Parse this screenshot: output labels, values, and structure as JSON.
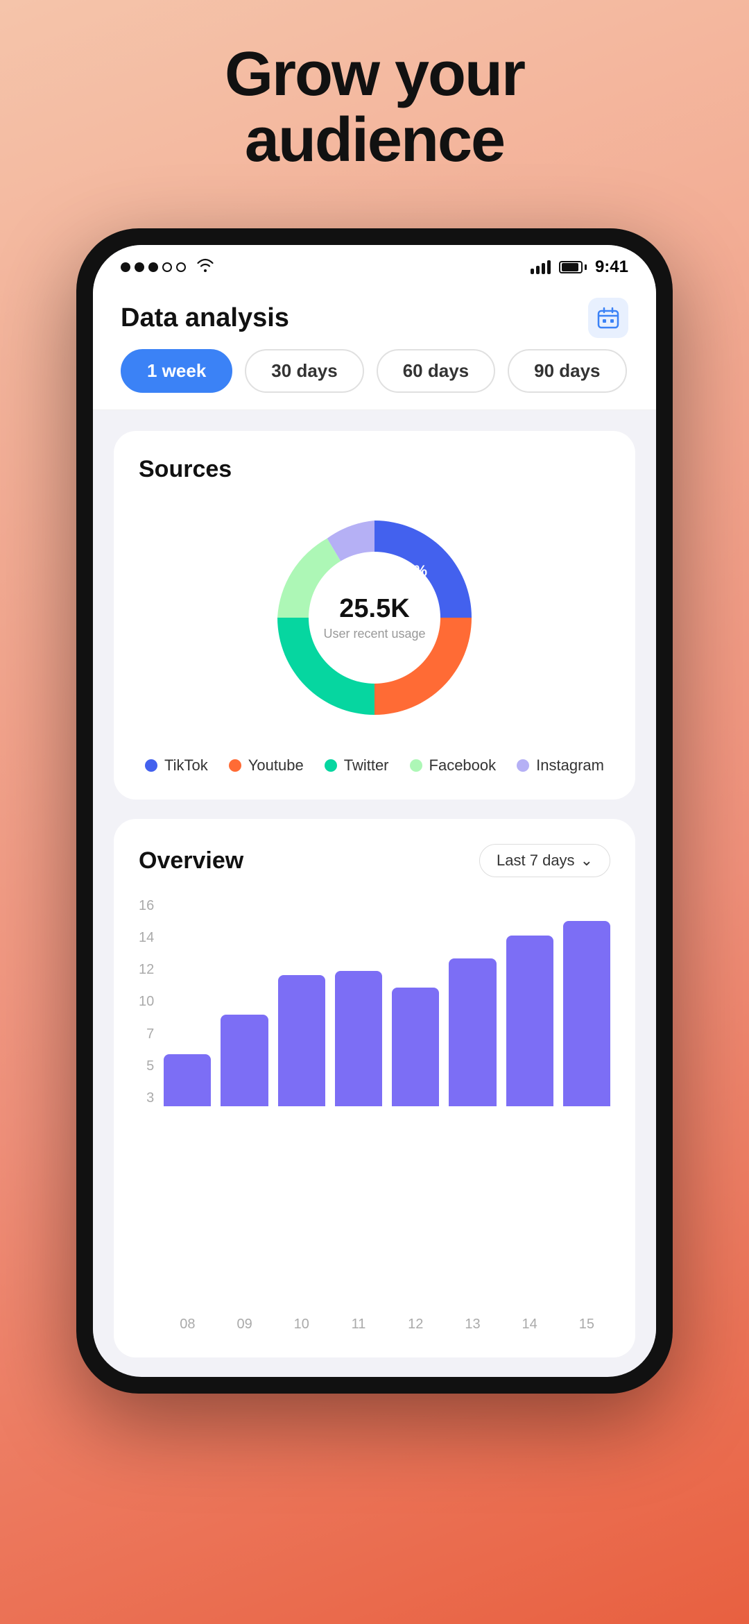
{
  "hero": {
    "line1": "Grow your",
    "line2": "audience"
  },
  "status_bar": {
    "time": "9:41",
    "dots": [
      "filled",
      "filled",
      "filled",
      "empty",
      "empty"
    ],
    "wifi": true,
    "signal_bars": 4,
    "battery_pct": 75
  },
  "header": {
    "title": "Data analysis",
    "calendar_icon": "📅"
  },
  "period_tabs": [
    {
      "label": "1 week",
      "active": true
    },
    {
      "label": "30 days",
      "active": false
    },
    {
      "label": "60 days",
      "active": false
    },
    {
      "label": "90 days",
      "active": false
    }
  ],
  "sources_card": {
    "title": "Sources",
    "donut": {
      "center_value": "25.5K",
      "center_label": "User recent usage",
      "segments": [
        {
          "label": "TikTok",
          "color": "#4361ee",
          "pct": 25,
          "start": 0,
          "end": 90
        },
        {
          "label": "Youtube",
          "color": "#ff6b35",
          "pct": 25,
          "start": 90,
          "end": 180
        },
        {
          "label": "Twitter",
          "color": "#06d6a0",
          "pct": 25,
          "start": 180,
          "end": 270
        },
        {
          "label": "Facebook",
          "color": "#adf7b6",
          "pct": 15,
          "start": 270,
          "end": 324
        },
        {
          "label": "Instagram",
          "color": "#b5b0f5",
          "pct": 10,
          "start": 324,
          "end": 360
        }
      ]
    },
    "legend": [
      {
        "label": "TikTok",
        "color": "#4361ee"
      },
      {
        "label": "Youtube",
        "color": "#ff6b35"
      },
      {
        "label": "Twitter",
        "color": "#06d6a0"
      },
      {
        "label": "Facebook",
        "color": "#adf7b6"
      },
      {
        "label": "Instagram",
        "color": "#b5b0f5"
      }
    ]
  },
  "overview_card": {
    "title": "Overview",
    "period_label": "Last 7 days",
    "y_labels": [
      "16",
      "14",
      "12",
      "10",
      "7",
      "5",
      "3"
    ],
    "bars": [
      {
        "x": "08",
        "value": 4,
        "height_pct": 25
      },
      {
        "x": "09",
        "value": 7,
        "height_pct": 44
      },
      {
        "x": "10",
        "value": 10,
        "height_pct": 63
      },
      {
        "x": "11",
        "value": 10,
        "height_pct": 65
      },
      {
        "x": "12",
        "value": 9,
        "height_pct": 57
      },
      {
        "x": "13",
        "value": 11,
        "height_pct": 71
      },
      {
        "x": "14",
        "value": 13,
        "height_pct": 82
      },
      {
        "x": "15",
        "value": 14,
        "height_pct": 89
      }
    ],
    "bar_color": "#7c6ef5"
  }
}
